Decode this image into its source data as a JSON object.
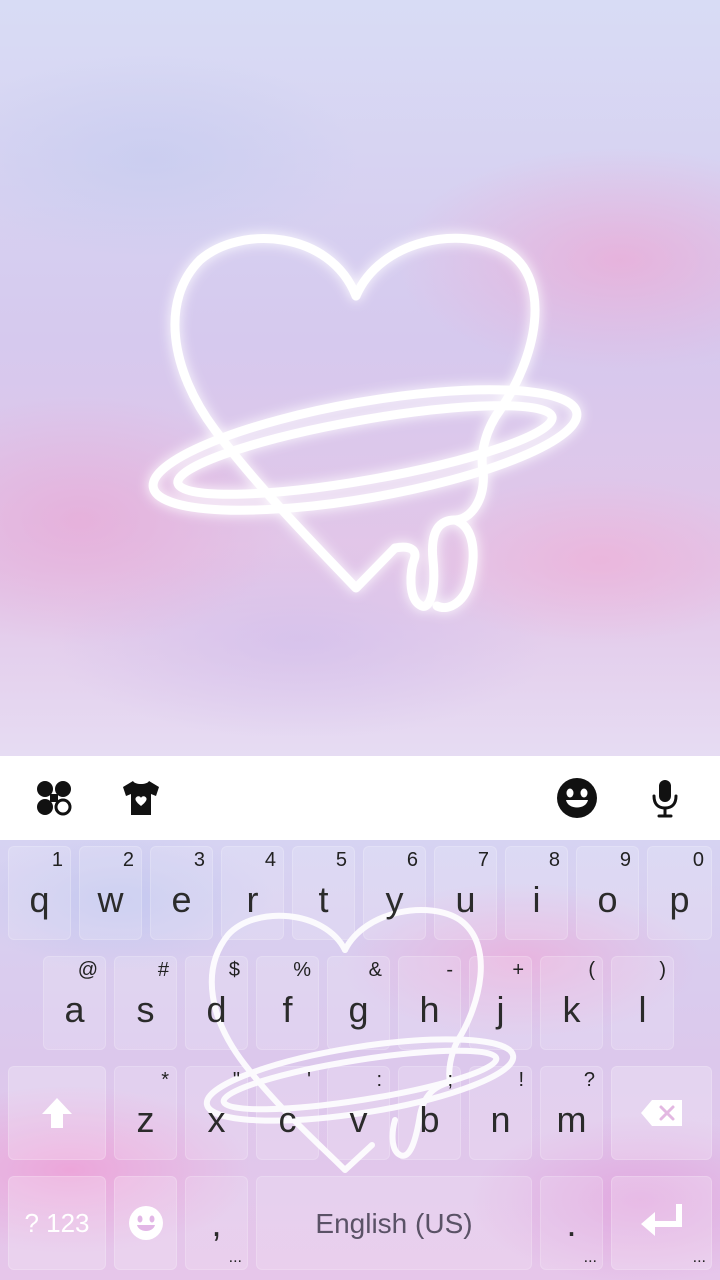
{
  "toolbar": {
    "icons": [
      "apps-icon",
      "theme-shirt-icon",
      "emoji-icon",
      "microphone-icon"
    ]
  },
  "keyboard": {
    "row1": [
      {
        "key": "q",
        "hint": "1"
      },
      {
        "key": "w",
        "hint": "2"
      },
      {
        "key": "e",
        "hint": "3"
      },
      {
        "key": "r",
        "hint": "4"
      },
      {
        "key": "t",
        "hint": "5"
      },
      {
        "key": "y",
        "hint": "6"
      },
      {
        "key": "u",
        "hint": "7"
      },
      {
        "key": "i",
        "hint": "8"
      },
      {
        "key": "o",
        "hint": "9"
      },
      {
        "key": "p",
        "hint": "0"
      }
    ],
    "row2": [
      {
        "key": "a",
        "hint": "@"
      },
      {
        "key": "s",
        "hint": "#"
      },
      {
        "key": "d",
        "hint": "$"
      },
      {
        "key": "f",
        "hint": "%"
      },
      {
        "key": "g",
        "hint": "&"
      },
      {
        "key": "h",
        "hint": "-"
      },
      {
        "key": "j",
        "hint": "+"
      },
      {
        "key": "k",
        "hint": "("
      },
      {
        "key": "l",
        "hint": ")"
      }
    ],
    "row3": [
      {
        "key": "z",
        "hint": "*"
      },
      {
        "key": "x",
        "hint": "\""
      },
      {
        "key": "c",
        "hint": "'"
      },
      {
        "key": "v",
        "hint": ":"
      },
      {
        "key": "b",
        "hint": ";"
      },
      {
        "key": "n",
        "hint": "!"
      },
      {
        "key": "m",
        "hint": "?"
      }
    ],
    "symbols_label": "? 123",
    "comma": ",",
    "space_label": "English (US)",
    "period": ".",
    "more_dots": "..."
  }
}
